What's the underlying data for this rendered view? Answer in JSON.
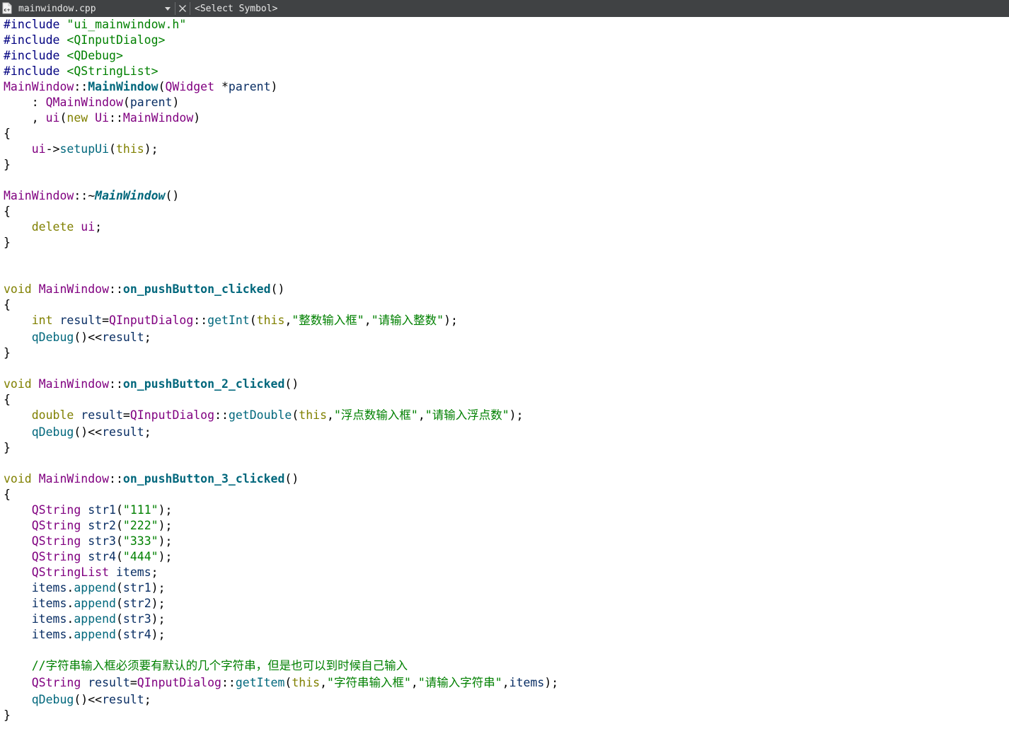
{
  "toolbar": {
    "file_name": "mainwindow.cpp",
    "symbol_selector": "<Select Symbol>",
    "close_label": "×"
  },
  "editor": {
    "lines": [
      [
        [
          "pp",
          "#include "
        ],
        [
          "str",
          "\"ui_mainwindow.h\""
        ]
      ],
      [
        [
          "pp",
          "#include "
        ],
        [
          "str",
          "<QInputDialog>"
        ]
      ],
      [
        [
          "pp",
          "#include "
        ],
        [
          "str",
          "<QDebug>"
        ]
      ],
      [
        [
          "pp",
          "#include "
        ],
        [
          "str",
          "<QStringList>"
        ]
      ],
      [
        [
          "ty",
          "MainWindow"
        ],
        [
          "op",
          "::"
        ],
        [
          "fnb",
          "MainWindow"
        ],
        [
          "op",
          "("
        ],
        [
          "ty",
          "QWidget"
        ],
        [
          "op",
          " *"
        ],
        [
          "var",
          "parent"
        ],
        [
          "op",
          ")"
        ]
      ],
      [
        [
          "op",
          "    : "
        ],
        [
          "ty",
          "QMainWindow"
        ],
        [
          "op",
          "("
        ],
        [
          "var",
          "parent"
        ],
        [
          "op",
          ")"
        ]
      ],
      [
        [
          "op",
          "    , "
        ],
        [
          "ty",
          "ui"
        ],
        [
          "op",
          "("
        ],
        [
          "kw",
          "new"
        ],
        [
          "op",
          " "
        ],
        [
          "ty",
          "Ui"
        ],
        [
          "op",
          "::"
        ],
        [
          "ty",
          "MainWindow"
        ],
        [
          "op",
          ")"
        ]
      ],
      [
        [
          "op",
          "{"
        ]
      ],
      [
        [
          "op",
          "    "
        ],
        [
          "ty",
          "ui"
        ],
        [
          "op",
          "->"
        ],
        [
          "fn",
          "setupUi"
        ],
        [
          "op",
          "("
        ],
        [
          "kw",
          "this"
        ],
        [
          "op",
          ");"
        ]
      ],
      [
        [
          "op",
          "}"
        ]
      ],
      [],
      [
        [
          "ty",
          "MainWindow"
        ],
        [
          "op",
          "::~"
        ],
        [
          "fni",
          "MainWindow"
        ],
        [
          "op",
          "()"
        ]
      ],
      [
        [
          "op",
          "{"
        ]
      ],
      [
        [
          "op",
          "    "
        ],
        [
          "kw",
          "delete"
        ],
        [
          "op",
          " "
        ],
        [
          "ty",
          "ui"
        ],
        [
          "op",
          ";"
        ]
      ],
      [
        [
          "op",
          "}"
        ]
      ],
      [],
      [],
      [
        [
          "kw",
          "void"
        ],
        [
          "op",
          " "
        ],
        [
          "ty",
          "MainWindow"
        ],
        [
          "op",
          "::"
        ],
        [
          "fnb",
          "on_pushButton_clicked"
        ],
        [
          "op",
          "()"
        ]
      ],
      [
        [
          "op",
          "{"
        ]
      ],
      [
        [
          "op",
          "    "
        ],
        [
          "kw",
          "int"
        ],
        [
          "op",
          " "
        ],
        [
          "var",
          "result"
        ],
        [
          "op",
          "="
        ],
        [
          "ty",
          "QInputDialog"
        ],
        [
          "op",
          "::"
        ],
        [
          "fn",
          "getInt"
        ],
        [
          "op",
          "("
        ],
        [
          "kw",
          "this"
        ],
        [
          "op",
          ","
        ],
        [
          "str",
          "\"整数输入框\""
        ],
        [
          "op",
          ","
        ],
        [
          "str",
          "\"请输入整数\""
        ],
        [
          "op",
          ");"
        ]
      ],
      [
        [
          "op",
          "    "
        ],
        [
          "fn",
          "qDebug"
        ],
        [
          "op",
          "()<<"
        ],
        [
          "var",
          "result"
        ],
        [
          "op",
          ";"
        ]
      ],
      [
        [
          "op",
          "}"
        ]
      ],
      [],
      [
        [
          "kw",
          "void"
        ],
        [
          "op",
          " "
        ],
        [
          "ty",
          "MainWindow"
        ],
        [
          "op",
          "::"
        ],
        [
          "fnb",
          "on_pushButton_2_clicked"
        ],
        [
          "op",
          "()"
        ]
      ],
      [
        [
          "op",
          "{"
        ]
      ],
      [
        [
          "op",
          "    "
        ],
        [
          "kw",
          "double"
        ],
        [
          "op",
          " "
        ],
        [
          "var",
          "result"
        ],
        [
          "op",
          "="
        ],
        [
          "ty",
          "QInputDialog"
        ],
        [
          "op",
          "::"
        ],
        [
          "fn",
          "getDouble"
        ],
        [
          "op",
          "("
        ],
        [
          "kw",
          "this"
        ],
        [
          "op",
          ","
        ],
        [
          "str",
          "\"浮点数输入框\""
        ],
        [
          "op",
          ","
        ],
        [
          "str",
          "\"请输入浮点数\""
        ],
        [
          "op",
          ");"
        ]
      ],
      [
        [
          "op",
          "    "
        ],
        [
          "fn",
          "qDebug"
        ],
        [
          "op",
          "()<<"
        ],
        [
          "var",
          "result"
        ],
        [
          "op",
          ";"
        ]
      ],
      [
        [
          "op",
          "}"
        ]
      ],
      [],
      [
        [
          "kw",
          "void"
        ],
        [
          "op",
          " "
        ],
        [
          "ty",
          "MainWindow"
        ],
        [
          "op",
          "::"
        ],
        [
          "fnb",
          "on_pushButton_3_clicked"
        ],
        [
          "op",
          "()"
        ]
      ],
      [
        [
          "op",
          "{"
        ]
      ],
      [
        [
          "op",
          "    "
        ],
        [
          "ty",
          "QString"
        ],
        [
          "op",
          " "
        ],
        [
          "var",
          "str1"
        ],
        [
          "op",
          "("
        ],
        [
          "str",
          "\"111\""
        ],
        [
          "op",
          ");"
        ]
      ],
      [
        [
          "op",
          "    "
        ],
        [
          "ty",
          "QString"
        ],
        [
          "op",
          " "
        ],
        [
          "var",
          "str2"
        ],
        [
          "op",
          "("
        ],
        [
          "str",
          "\"222\""
        ],
        [
          "op",
          ");"
        ]
      ],
      [
        [
          "op",
          "    "
        ],
        [
          "ty",
          "QString"
        ],
        [
          "op",
          " "
        ],
        [
          "var",
          "str3"
        ],
        [
          "op",
          "("
        ],
        [
          "str",
          "\"333\""
        ],
        [
          "op",
          ");"
        ]
      ],
      [
        [
          "op",
          "    "
        ],
        [
          "ty",
          "QString"
        ],
        [
          "op",
          " "
        ],
        [
          "var",
          "str4"
        ],
        [
          "op",
          "("
        ],
        [
          "str",
          "\"444\""
        ],
        [
          "op",
          ");"
        ]
      ],
      [
        [
          "op",
          "    "
        ],
        [
          "ty",
          "QStringList"
        ],
        [
          "op",
          " "
        ],
        [
          "var",
          "items"
        ],
        [
          "op",
          ";"
        ]
      ],
      [
        [
          "op",
          "    "
        ],
        [
          "var",
          "items"
        ],
        [
          "op",
          "."
        ],
        [
          "fn",
          "append"
        ],
        [
          "op",
          "("
        ],
        [
          "var",
          "str1"
        ],
        [
          "op",
          ");"
        ]
      ],
      [
        [
          "op",
          "    "
        ],
        [
          "var",
          "items"
        ],
        [
          "op",
          "."
        ],
        [
          "fn",
          "append"
        ],
        [
          "op",
          "("
        ],
        [
          "var",
          "str2"
        ],
        [
          "op",
          ");"
        ]
      ],
      [
        [
          "op",
          "    "
        ],
        [
          "var",
          "items"
        ],
        [
          "op",
          "."
        ],
        [
          "fn",
          "append"
        ],
        [
          "op",
          "("
        ],
        [
          "var",
          "str3"
        ],
        [
          "op",
          ");"
        ]
      ],
      [
        [
          "op",
          "    "
        ],
        [
          "var",
          "items"
        ],
        [
          "op",
          "."
        ],
        [
          "fn",
          "append"
        ],
        [
          "op",
          "("
        ],
        [
          "var",
          "str4"
        ],
        [
          "op",
          ");"
        ]
      ],
      [],
      [
        [
          "op",
          "    "
        ],
        [
          "cm",
          "//字符串输入框必须要有默认的几个字符串，但是也可以到时候自己输入"
        ]
      ],
      [
        [
          "op",
          "    "
        ],
        [
          "ty",
          "QString"
        ],
        [
          "op",
          " "
        ],
        [
          "var",
          "result"
        ],
        [
          "op",
          "="
        ],
        [
          "ty",
          "QInputDialog"
        ],
        [
          "op",
          "::"
        ],
        [
          "fn",
          "getItem"
        ],
        [
          "op",
          "("
        ],
        [
          "kw",
          "this"
        ],
        [
          "op",
          ","
        ],
        [
          "str",
          "\"字符串输入框\""
        ],
        [
          "op",
          ","
        ],
        [
          "str",
          "\"请输入字符串\""
        ],
        [
          "op",
          ","
        ],
        [
          "var",
          "items"
        ],
        [
          "op",
          ");"
        ]
      ],
      [
        [
          "op",
          "    "
        ],
        [
          "fn",
          "qDebug"
        ],
        [
          "op",
          "()<<"
        ],
        [
          "var",
          "result"
        ],
        [
          "op",
          ";"
        ]
      ],
      [
        [
          "op",
          "}"
        ]
      ]
    ]
  }
}
